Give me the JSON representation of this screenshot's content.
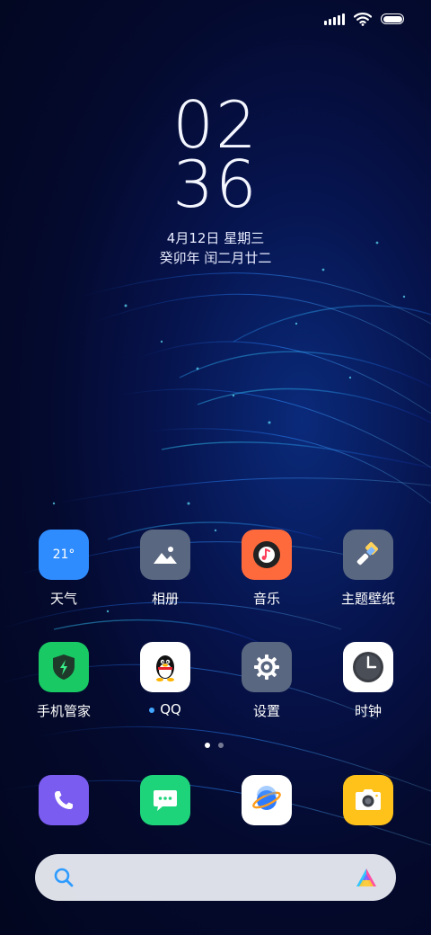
{
  "status_bar": {
    "signal_icon": "cellular-signal-icon",
    "wifi_icon": "wifi-icon",
    "battery_icon": "battery-icon",
    "battery_level": 1.0
  },
  "clock": {
    "hours": "02",
    "minutes": "36"
  },
  "date": {
    "gregorian": "4月12日 星期三",
    "lunar": "癸卯年 闰二月廿二"
  },
  "apps": [
    {
      "label": "天气",
      "icon": "weather-icon",
      "value": "21°",
      "color": "#2f8cff"
    },
    {
      "label": "相册",
      "icon": "gallery-icon",
      "color": "#5a6780"
    },
    {
      "label": "音乐",
      "icon": "music-icon",
      "color": "#ff6a3d"
    },
    {
      "label": "主题壁纸",
      "icon": "theme-brush-icon",
      "color": "#5a6780"
    },
    {
      "label": "手机管家",
      "icon": "security-shield-icon",
      "color": "#18c964"
    },
    {
      "label": "QQ",
      "icon": "qq-penguin-icon",
      "color": "#ffffff",
      "new_indicator": true
    },
    {
      "label": "设置",
      "icon": "gear-icon",
      "color": "#5a6780"
    },
    {
      "label": "时钟",
      "icon": "clock-icon",
      "color": "#ffffff"
    }
  ],
  "page_indicator": {
    "pages": 2,
    "current": 1
  },
  "dock": [
    {
      "icon": "phone-icon",
      "color": "#7a5cf0"
    },
    {
      "icon": "messages-icon",
      "color": "#1ed47a"
    },
    {
      "icon": "browser-planet-icon",
      "color": "#ffffff"
    },
    {
      "icon": "camera-icon",
      "color": "#ffc21a"
    }
  ],
  "search_bar": {
    "search_icon": "search-icon",
    "assistant_icon": "assistant-logo-icon"
  }
}
